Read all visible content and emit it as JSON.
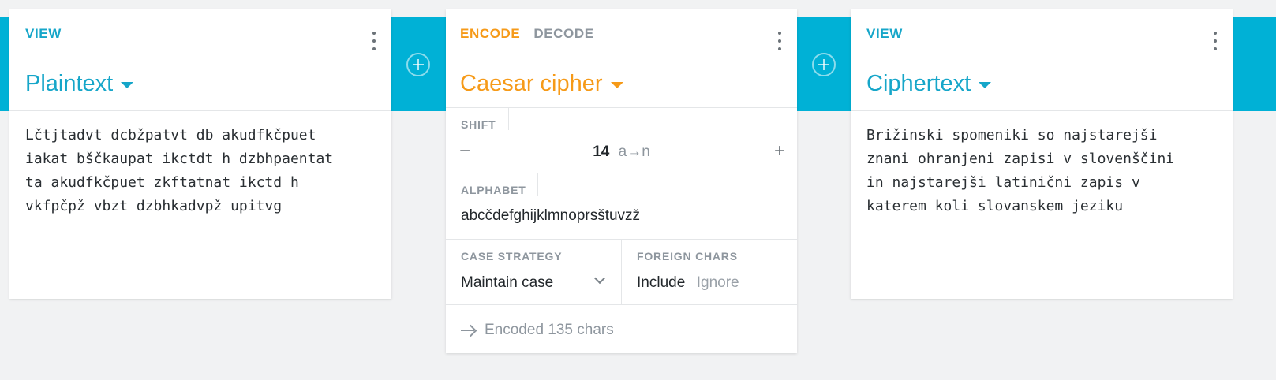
{
  "left_card": {
    "mode_label": "VIEW",
    "title": "Plaintext",
    "content": "Lčtjtadvt dcbžpatvt db akudfkčpuet\niakat bščkaupat ikctdt h dzbhpaentat\nta akudfkčpuet zkftatnat ikctd h\nvkfpčpž vbzt dzbhkadvpž upitvg"
  },
  "cipher_card": {
    "encode_label": "ENCODE",
    "decode_label": "DECODE",
    "title": "Caesar cipher",
    "shift": {
      "label": "SHIFT",
      "minus": "−",
      "plus": "+",
      "value": "14",
      "mapping": "a→n"
    },
    "alphabet": {
      "label": "ALPHABET",
      "value": "abcčdefghijklmnoprsštuvzž"
    },
    "case_strategy": {
      "label": "CASE STRATEGY",
      "value": "Maintain case"
    },
    "foreign_chars": {
      "label": "FOREIGN CHARS",
      "include": "Include",
      "ignore": "Ignore",
      "selected": "Include"
    },
    "status": "Encoded 135 chars"
  },
  "right_card": {
    "mode_label": "VIEW",
    "title": "Ciphertext",
    "content": "Brižinski spomeniki so najstarejši\nznani ohranjeni zapisi v slovenščini\nin najstarejši latinični zapis v\nkaterem koli slovanskem jeziku"
  },
  "colors": {
    "accent": "#00b1d6",
    "view_blue": "#16a6c9",
    "encode_orange": "#f69a18",
    "muted": "#8e969e",
    "background": "#f1f2f3"
  },
  "icons": [
    "kebab-menu-icon",
    "caret-down-icon",
    "add-circle-icon",
    "chevron-down-icon",
    "arrow-right-icon"
  ]
}
